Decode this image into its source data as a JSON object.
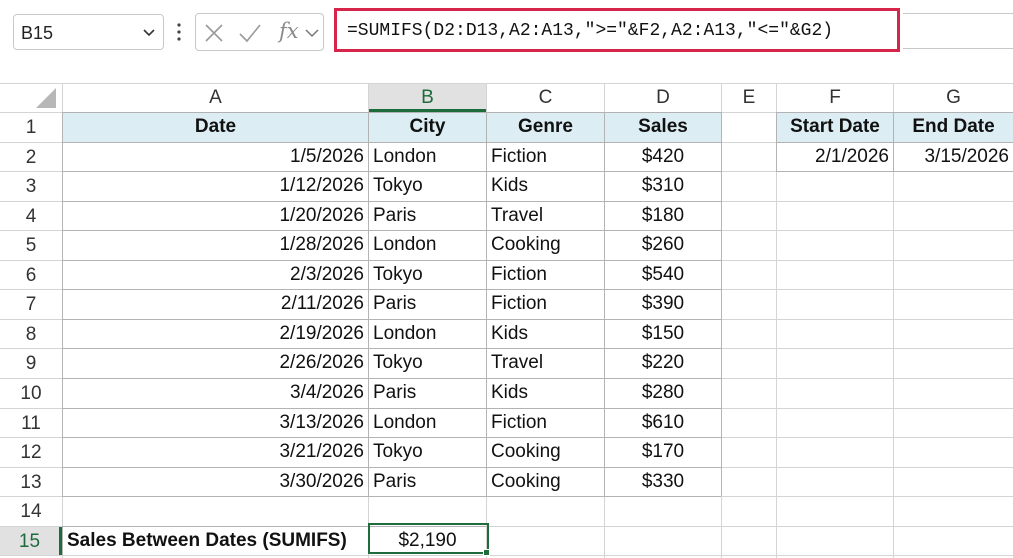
{
  "name_box": {
    "value": "B15"
  },
  "formula_bar": {
    "fx_label": "fx",
    "formula": "=SUMIFS(D2:D13,A2:A13,\">=\"&F2,A2:A13,\"<=\"&G2)"
  },
  "columns": [
    "A",
    "B",
    "C",
    "D",
    "E",
    "F",
    "G"
  ],
  "rows": [
    "1",
    "2",
    "3",
    "4",
    "5",
    "6",
    "7",
    "8",
    "9",
    "10",
    "11",
    "12",
    "13",
    "14",
    "15"
  ],
  "table": {
    "headers": [
      "Date",
      "City",
      "Genre",
      "Sales"
    ],
    "records": [
      [
        "1/5/2026",
        "London",
        "Fiction",
        "$420"
      ],
      [
        "1/12/2026",
        "Tokyo",
        "Kids",
        "$310"
      ],
      [
        "1/20/2026",
        "Paris",
        "Travel",
        "$180"
      ],
      [
        "1/28/2026",
        "London",
        "Cooking",
        "$260"
      ],
      [
        "2/3/2026",
        "Tokyo",
        "Fiction",
        "$540"
      ],
      [
        "2/11/2026",
        "Paris",
        "Fiction",
        "$390"
      ],
      [
        "2/19/2026",
        "London",
        "Kids",
        "$150"
      ],
      [
        "2/26/2026",
        "Tokyo",
        "Travel",
        "$220"
      ],
      [
        "3/4/2026",
        "Paris",
        "Kids",
        "$280"
      ],
      [
        "3/13/2026",
        "London",
        "Fiction",
        "$610"
      ],
      [
        "3/21/2026",
        "Tokyo",
        "Cooking",
        "$170"
      ],
      [
        "3/30/2026",
        "Paris",
        "Cooking",
        "$330"
      ]
    ]
  },
  "criteria": {
    "start_label": "Start Date",
    "end_label": "End Date",
    "start_value": "2/1/2026",
    "end_value": "3/15/2026"
  },
  "result": {
    "label": "Sales Between Dates (SUMIFS)",
    "value": "$2,190"
  },
  "colors": {
    "header_fill": "#dcedf4",
    "selection": "#1e6b3c",
    "formula_highlight": "#d6244a"
  }
}
